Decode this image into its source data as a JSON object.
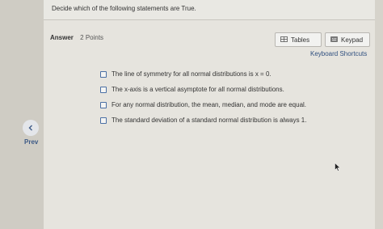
{
  "question": {
    "text": "Decide which of the following statements are True."
  },
  "answer": {
    "label": "Answer",
    "points": "2 Points"
  },
  "toolbar": {
    "tables_label": "Tables",
    "keypad_label": "Keypad",
    "shortcuts_label": "Keyboard Shortcuts"
  },
  "options": [
    "The line of symmetry for all normal distributions is x = 0.",
    "The x-axis is a vertical asymptote for all normal distributions.",
    "For any normal distribution, the mean, median, and mode are equal.",
    "The standard deviation of a standard normal distribution is always 1."
  ],
  "nav": {
    "prev_label": "Prev"
  },
  "colors": {
    "accent": "#3d5a86",
    "checkbox_border": "#4a6fa5",
    "panel": "#e6e4de"
  },
  "icons": {
    "prev": "chevron-left-icon",
    "tables": "table-icon",
    "keypad": "keypad-icon"
  }
}
